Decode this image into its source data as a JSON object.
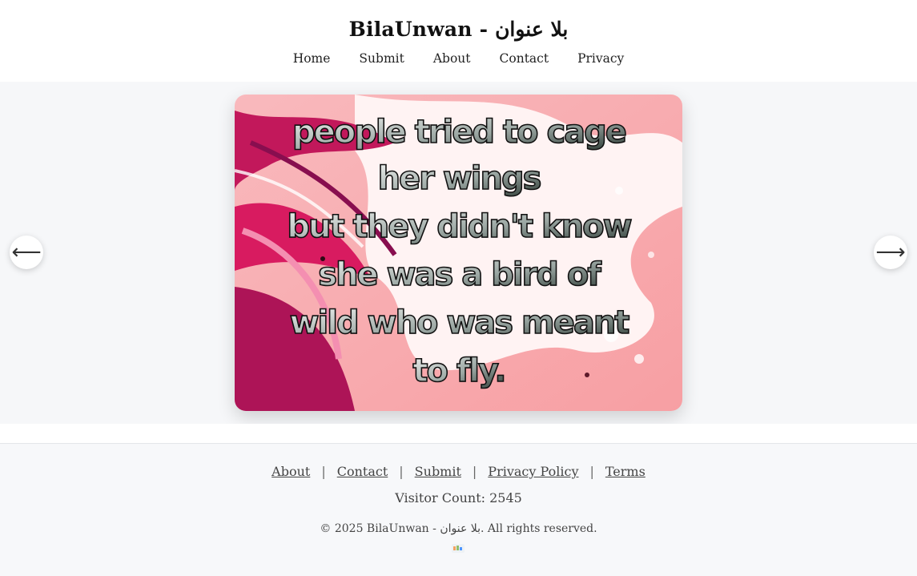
{
  "site": {
    "title": "BilaUnwan - بلا عنوان"
  },
  "nav": {
    "items": [
      {
        "label": "Home"
      },
      {
        "label": "Submit"
      },
      {
        "label": "About"
      },
      {
        "label": "Contact"
      },
      {
        "label": "Privacy"
      }
    ]
  },
  "gallery": {
    "prev_label": "⟵",
    "next_label": "⟶",
    "quote_lines": [
      "people tried to cage",
      "her wings",
      "but they didn't know",
      "she was a bird of",
      "wild who was meant",
      "to fly."
    ],
    "colors": {
      "background_pink": "#f7a3a6",
      "magenta": "#c2185b",
      "text_fill": "#e9ece9"
    }
  },
  "footer": {
    "links": [
      {
        "label": "About"
      },
      {
        "label": "Contact"
      },
      {
        "label": "Submit"
      },
      {
        "label": "Privacy Policy"
      },
      {
        "label": "Terms"
      }
    ],
    "separator": "|",
    "visitor_count": "Visitor Count: 2545",
    "copyright": "© 2025 BilaUnwan - بلا عنوان. All rights reserved."
  }
}
